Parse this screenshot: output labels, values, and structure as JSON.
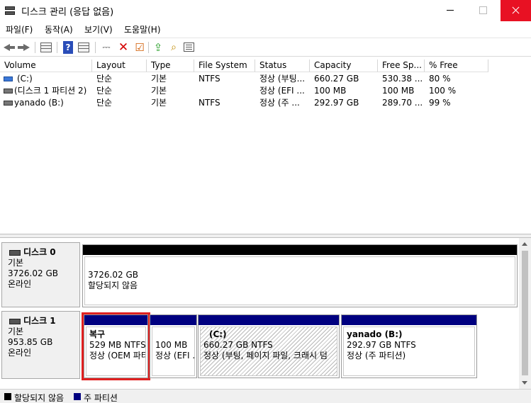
{
  "window": {
    "title": "디스크 관리 (응답 없음)"
  },
  "menu": [
    {
      "label": "파일(F)"
    },
    {
      "label": "동작(A)"
    },
    {
      "label": "보기(V)"
    },
    {
      "label": "도움말(H)"
    }
  ],
  "columns": [
    "Volume",
    "Layout",
    "Type",
    "File System",
    "Status",
    "Capacity",
    "Free Sp...",
    "% Free"
  ],
  "volumes": [
    {
      "name": "(C:)",
      "layout": "단순",
      "type": "기본",
      "fs": "NTFS",
      "status": "정상 (부팅...",
      "capacity": "660.27 GB",
      "free": "530.38 ...",
      "pct": "80 %"
    },
    {
      "name": "(디스크 1 파티션 2)",
      "layout": "단순",
      "type": "기본",
      "fs": "",
      "status": "정상 (EFI ...",
      "capacity": "100 MB",
      "free": "100 MB",
      "pct": "100 %"
    },
    {
      "name": "yanado (B:)",
      "layout": "단순",
      "type": "기본",
      "fs": "NTFS",
      "status": "정상 (주 ...",
      "capacity": "292.97 GB",
      "free": "289.70 ...",
      "pct": "99 %"
    }
  ],
  "disks": [
    {
      "name": "디스크 0",
      "kind": "기본",
      "size": "3726.02 GB",
      "state": "온라인",
      "partitions": [
        {
          "size": "3726.02 GB",
          "status": "할당되지 않음"
        }
      ]
    },
    {
      "name": "디스크 1",
      "kind": "기본",
      "size": "953.85 GB",
      "state": "온라인",
      "partitions": [
        {
          "label": "복구",
          "size": "529 MB NTFS",
          "status": "정상 (OEM 파티"
        },
        {
          "size": "100 MB",
          "status": "정상 (EFI ..."
        },
        {
          "label": "(C:)",
          "size": "660.27 GB NTFS",
          "status": "정상 (부팅, 페이지 파일, 크래시 덤"
        },
        {
          "label": "yanado  (B:)",
          "size": "292.97 GB NTFS",
          "status": "정상 (주 파티션)"
        }
      ]
    }
  ],
  "legend": [
    {
      "label": "할당되지 않음",
      "color": "#000000"
    },
    {
      "label": "주 파티션",
      "color": "#000080"
    }
  ],
  "colors": {
    "primary_bar": "#000080",
    "unallocated_bar": "#000000",
    "selection": "#e02020",
    "close_button": "#e81123"
  }
}
